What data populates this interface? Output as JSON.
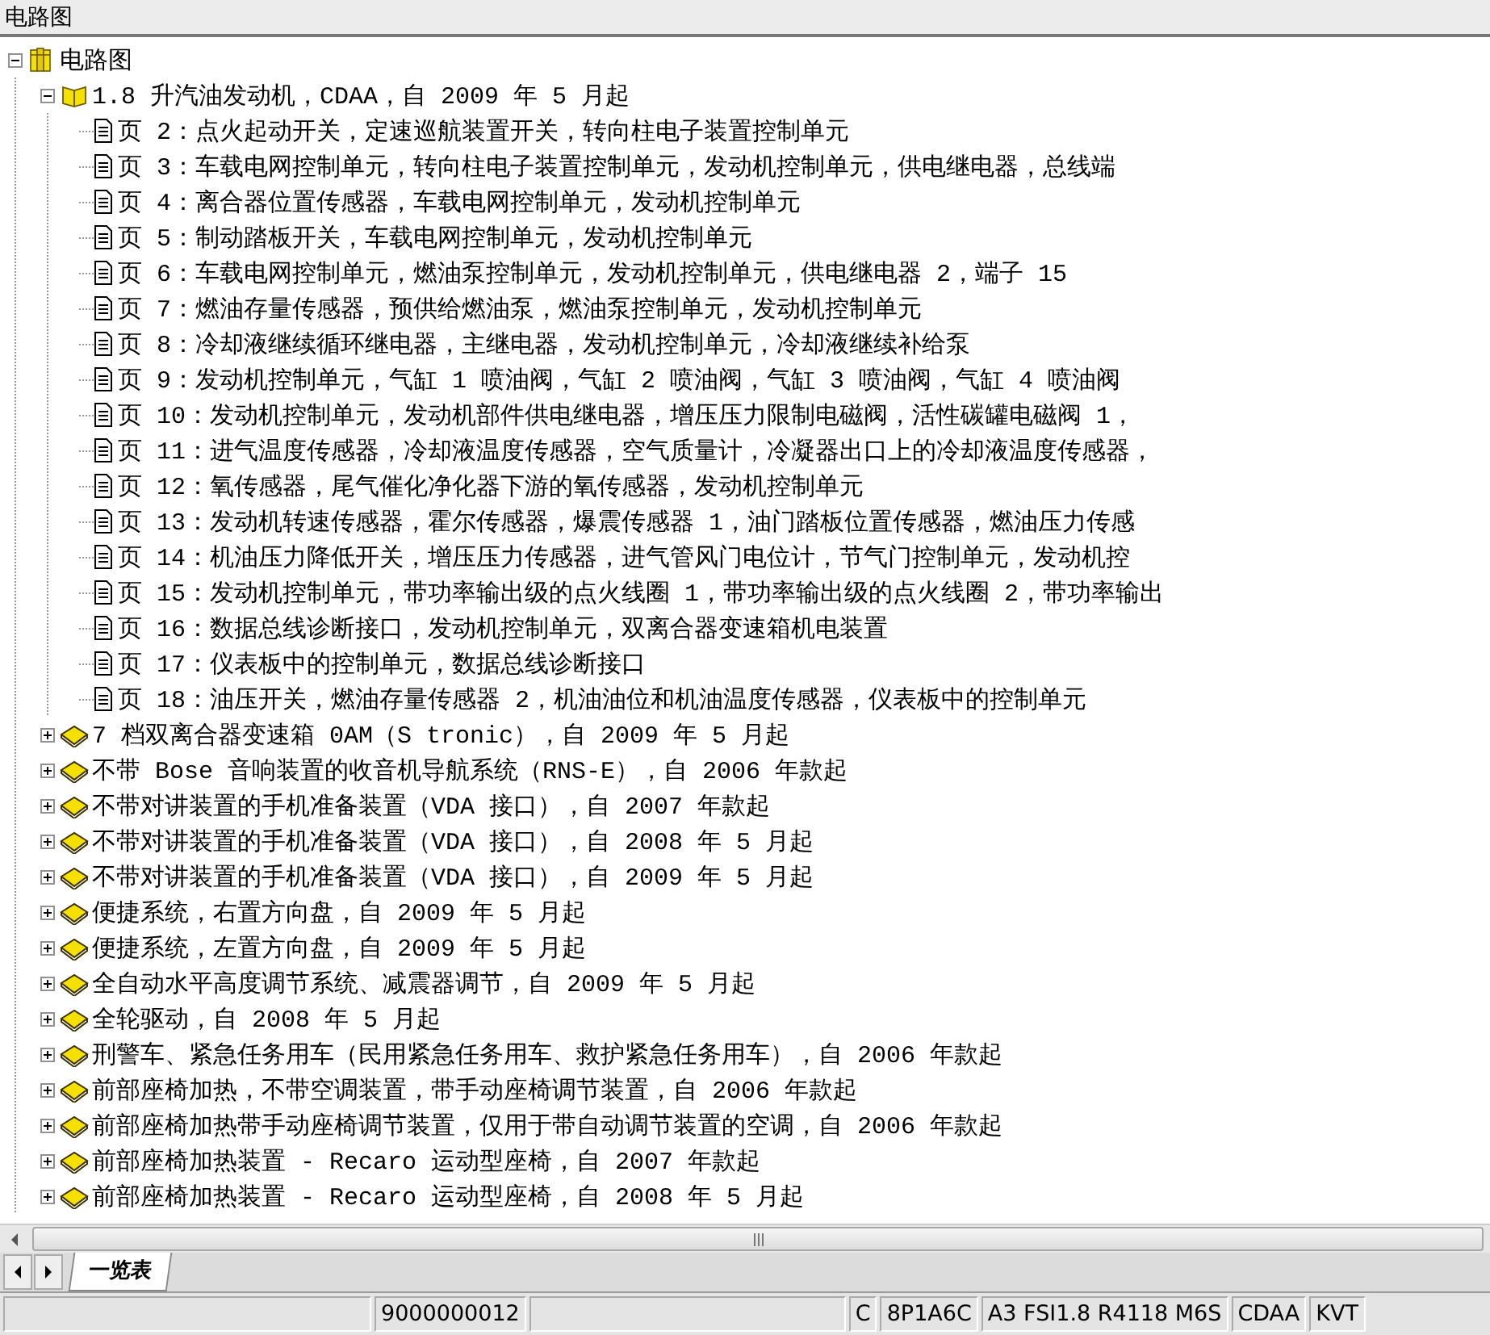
{
  "panel": {
    "title": "电路图"
  },
  "tree": [
    {
      "kind": "root",
      "label": "电路图",
      "expanded": true,
      "children": [
        {
          "kind": "chapter",
          "label": "1.8 升汽油发动机，CDAA，自 2009 年 5 月起",
          "expanded": true,
          "children": [
            {
              "kind": "page",
              "label": "页 2：点火起动开关，定速巡航装置开关，转向柱电子装置控制单元"
            },
            {
              "kind": "page",
              "label": "页 3：车载电网控制单元，转向柱电子装置控制单元，发动机控制单元，供电继电器，总线端"
            },
            {
              "kind": "page",
              "label": "页 4：离合器位置传感器，车载电网控制单元，发动机控制单元"
            },
            {
              "kind": "page",
              "label": "页 5：制动踏板开关，车载电网控制单元，发动机控制单元"
            },
            {
              "kind": "page",
              "label": "页 6：车载电网控制单元，燃油泵控制单元，发动机控制单元，供电继电器 2，端子 15"
            },
            {
              "kind": "page",
              "label": "页 7：燃油存量传感器，预供给燃油泵，燃油泵控制单元，发动机控制单元"
            },
            {
              "kind": "page",
              "label": "页 8：冷却液继续循环继电器，主继电器，发动机控制单元，冷却液继续补给泵"
            },
            {
              "kind": "page",
              "label": "页 9：发动机控制单元，气缸 1 喷油阀，气缸 2 喷油阀，气缸 3 喷油阀，气缸 4 喷油阀"
            },
            {
              "kind": "page",
              "label": "页 10：发动机控制单元，发动机部件供电继电器，增压压力限制电磁阀，活性碳罐电磁阀 1，"
            },
            {
              "kind": "page",
              "label": "页 11：进气温度传感器，冷却液温度传感器，空气质量计，冷凝器出口上的冷却液温度传感器，"
            },
            {
              "kind": "page",
              "label": "页 12：氧传感器，尾气催化净化器下游的氧传感器，发动机控制单元"
            },
            {
              "kind": "page",
              "label": "页 13：发动机转速传感器，霍尔传感器，爆震传感器 1，油门踏板位置传感器，燃油压力传感"
            },
            {
              "kind": "page",
              "label": "页 14：机油压力降低开关，增压压力传感器，进气管风门电位计，节气门控制单元，发动机控"
            },
            {
              "kind": "page",
              "label": "页 15：发动机控制单元，带功率输出级的点火线圈 1，带功率输出级的点火线圈 2，带功率输出"
            },
            {
              "kind": "page",
              "label": "页 16：数据总线诊断接口，发动机控制单元，双离合器变速箱机电装置"
            },
            {
              "kind": "page",
              "label": "页 17：仪表板中的控制单元，数据总线诊断接口"
            },
            {
              "kind": "page",
              "label": "页 18：油压开关，燃油存量传感器 2，机油油位和机油温度传感器，仪表板中的控制单元"
            }
          ]
        },
        {
          "kind": "chapter",
          "label": "7 档双离合器变速箱 0AM（S tronic），自 2009 年 5 月起",
          "expanded": false
        },
        {
          "kind": "chapter",
          "label": "不带 Bose 音响装置的收音机导航系统（RNS-E），自 2006 年款起",
          "expanded": false
        },
        {
          "kind": "chapter",
          "label": "不带对讲装置的手机准备装置（VDA 接口），自 2007 年款起",
          "expanded": false
        },
        {
          "kind": "chapter",
          "label": "不带对讲装置的手机准备装置（VDA 接口），自 2008 年 5 月起",
          "expanded": false
        },
        {
          "kind": "chapter",
          "label": "不带对讲装置的手机准备装置（VDA 接口），自 2009 年 5 月起",
          "expanded": false
        },
        {
          "kind": "chapter",
          "label": "便捷系统，右置方向盘，自 2009 年 5 月起",
          "expanded": false
        },
        {
          "kind": "chapter",
          "label": "便捷系统，左置方向盘，自 2009 年 5 月起",
          "expanded": false
        },
        {
          "kind": "chapter",
          "label": "全自动水平高度调节系统、减震器调节，自 2009 年 5 月起",
          "expanded": false
        },
        {
          "kind": "chapter",
          "label": "全轮驱动，自 2008 年 5 月起",
          "expanded": false
        },
        {
          "kind": "chapter",
          "label": "刑警车、紧急任务用车（民用紧急任务用车、救护紧急任务用车），自 2006 年款起",
          "expanded": false
        },
        {
          "kind": "chapter",
          "label": "前部座椅加热，不带空调装置，带手动座椅调节装置，自 2006 年款起",
          "expanded": false
        },
        {
          "kind": "chapter",
          "label": "前部座椅加热带手动座椅调节装置，仅用于带自动调节装置的空调，自 2006 年款起",
          "expanded": false
        },
        {
          "kind": "chapter",
          "label": "前部座椅加热装置 - Recaro 运动型座椅，自 2007 年款起",
          "expanded": false
        },
        {
          "kind": "chapter",
          "label": "前部座椅加热装置 - Recaro 运动型座椅，自 2008 年 5 月起",
          "expanded": false
        }
      ]
    }
  ],
  "tabs": [
    {
      "label": "一览表",
      "selected": true
    }
  ],
  "status_bar": [
    "9000000012",
    "C",
    "8P1A6C",
    "A3 FSI1.8 R4118 M6S",
    "CDAA",
    "KVT"
  ]
}
